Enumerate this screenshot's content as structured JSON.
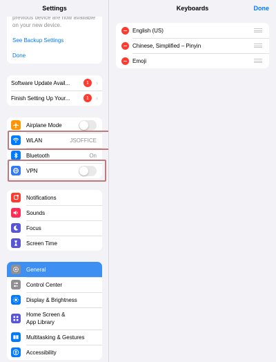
{
  "sidebar": {
    "title": "Settings",
    "backup": {
      "text": "previous device are now available on your new device.",
      "see_backup_label": "See Backup Settings",
      "done_label": "Done"
    },
    "updates": [
      {
        "label": "Software Update Avail...",
        "badge": "1"
      },
      {
        "label": "Finish Setting Up Your...",
        "badge": "1"
      }
    ],
    "connectivity": [
      {
        "label": "Airplane Mode",
        "type": "toggle",
        "state": "off",
        "icon": "airplane-icon",
        "color": "#ff9500"
      },
      {
        "label": "WLAN",
        "value": "JSOFFICE",
        "icon": "wifi-icon",
        "color": "#007aff"
      },
      {
        "label": "Bluetooth",
        "value": "On",
        "icon": "bluetooth-icon",
        "color": "#007aff"
      },
      {
        "label": "VPN",
        "type": "toggle",
        "state": "off",
        "icon": "vpn-globe-icon",
        "color": "#3478f6"
      }
    ],
    "notifications": [
      {
        "label": "Notifications",
        "icon": "bell-icon",
        "color": "#ff3b30"
      },
      {
        "label": "Sounds",
        "icon": "speaker-icon",
        "color": "#ff2d55"
      },
      {
        "label": "Focus",
        "icon": "moon-icon",
        "color": "#5856d6"
      },
      {
        "label": "Screen Time",
        "icon": "hourglass-icon",
        "color": "#5856d6"
      }
    ],
    "general": [
      {
        "label": "General",
        "icon": "gear-icon",
        "color": "#8e8e93",
        "selected": true
      },
      {
        "label": "Control Center",
        "icon": "sliders-icon",
        "color": "#8e8e93"
      },
      {
        "label": "Display & Brightness",
        "icon": "sun-icon",
        "color": "#007aff"
      },
      {
        "label": "Home Screen &",
        "label2": "App Library",
        "icon": "grid-icon",
        "color": "#5856d6"
      },
      {
        "label": "Multitasking & Gestures",
        "icon": "multitask-icon",
        "color": "#007aff"
      },
      {
        "label": "Accessibility",
        "icon": "accessibility-icon",
        "color": "#007aff"
      }
    ]
  },
  "detail": {
    "title": "Keyboards",
    "done_label": "Done",
    "keyboards": [
      {
        "label": "English (US)"
      },
      {
        "label": "Chinese, Simplified – Pinyin"
      },
      {
        "label": "Emoji"
      }
    ]
  },
  "colors": {
    "accent": "#007aff",
    "selected_row": "#3d8ff2",
    "highlight_box": "#c0797b",
    "badge": "#ff3b30"
  }
}
